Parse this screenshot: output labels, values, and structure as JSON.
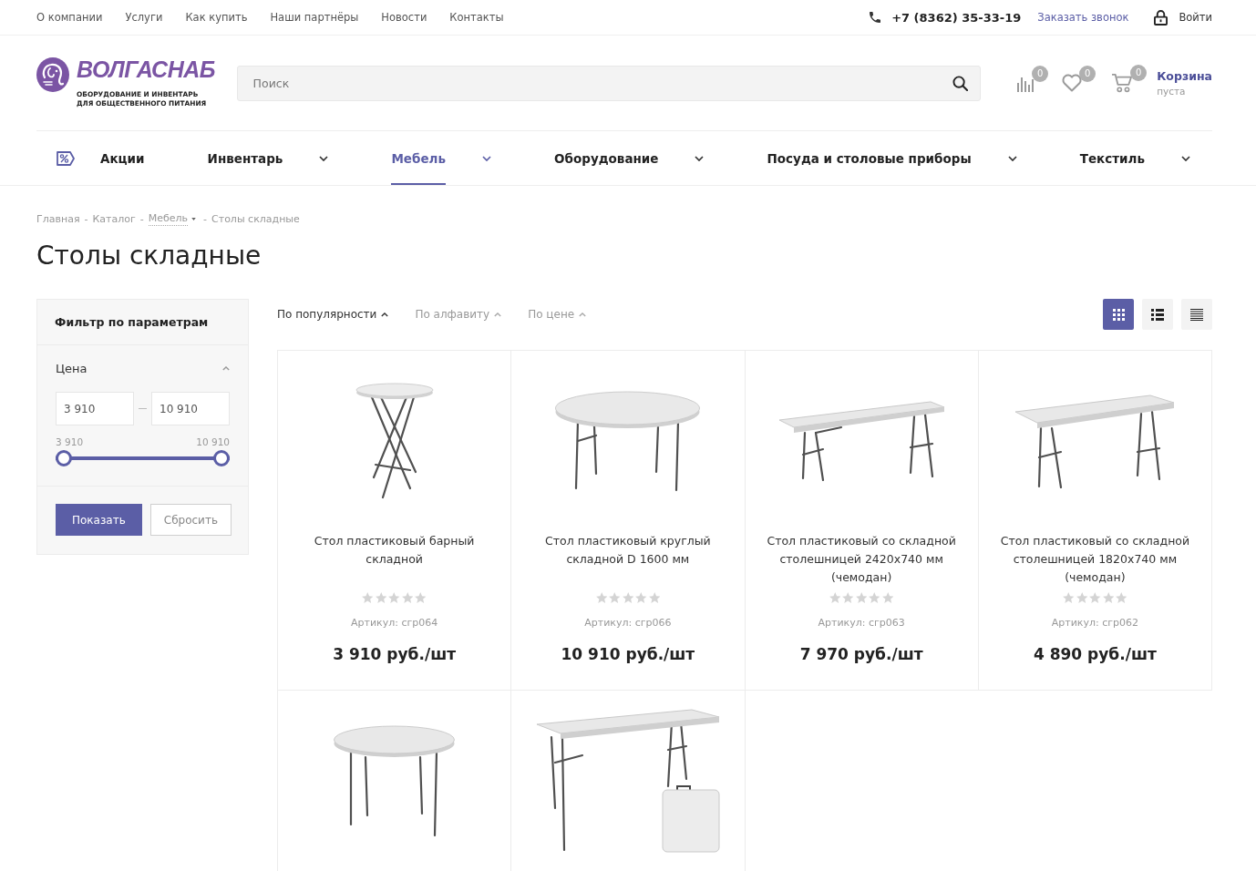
{
  "top_bar": {
    "links": [
      "О компании",
      "Услуги",
      "Как купить",
      "Наши партнёры",
      "Новости",
      "Контакты"
    ],
    "phone": "+7 (8362) 35-33-19",
    "callback": "Заказать звонок",
    "login": "Войти"
  },
  "header": {
    "logo": {
      "name": "ВОЛГАСНАБ",
      "tagline": [
        "ОБОРУДОВАНИЕ И ИНВЕНТАРЬ",
        "ДЛЯ ОБЩЕСТВЕННОГО ПИТАНИЯ"
      ]
    },
    "search": {
      "placeholder": "Поиск"
    },
    "counters": [
      {
        "kind": "compare",
        "count": "0"
      },
      {
        "kind": "favorites",
        "count": "0"
      },
      {
        "kind": "cart",
        "count": "0"
      }
    ],
    "cart": {
      "title": "Корзина",
      "status": "пуста"
    }
  },
  "nav": [
    {
      "label": "Акции",
      "kind": "promo",
      "selected": false
    },
    {
      "label": "Инвентарь",
      "kind": "menu",
      "selected": false
    },
    {
      "label": "Мебель",
      "kind": "menu",
      "selected": true
    },
    {
      "label": "Оборудование",
      "kind": "menu",
      "selected": false
    },
    {
      "label": "Посуда и столовые приборы",
      "kind": "menu",
      "selected": false
    },
    {
      "label": "Текстиль",
      "kind": "menu",
      "selected": false
    }
  ],
  "breadcrumbs": {
    "separator": "-",
    "items": [
      {
        "label": "Главная",
        "dropdown": false
      },
      {
        "label": "Каталог",
        "dropdown": false
      },
      {
        "label": "Мебель",
        "dropdown": true
      },
      {
        "label": "Столы складные",
        "dropdown": false
      }
    ]
  },
  "title": "Столы складные",
  "filter": {
    "title": "Фильтр по параметрам",
    "section": {
      "label": "Цена",
      "expanded": true,
      "from": {
        "value": "3 910"
      },
      "to": {
        "value": "10 910"
      },
      "min_label": "3 910",
      "max_label": "10 910",
      "level": 1
    },
    "buttons": [
      {
        "label": "Показать",
        "kind": "primary"
      },
      {
        "label": "Сбросить",
        "kind": "secondary"
      }
    ]
  },
  "sort": [
    {
      "label": "По популярности",
      "selected": true
    },
    {
      "label": "По алфавиту",
      "selected": false
    },
    {
      "label": "По цене",
      "selected": false
    }
  ],
  "views": [
    {
      "kind": "grid",
      "selected": true
    },
    {
      "kind": "list",
      "selected": false
    },
    {
      "kind": "table",
      "selected": false
    }
  ],
  "products": [
    {
      "kind": "bar",
      "title": "Стол пластиковый барный складной",
      "stars": 0,
      "article": "Артикул: сгр064",
      "price": "3 910 руб./шт"
    },
    {
      "kind": "round",
      "title": "Стол пластиковый круглый складной D 1600 мм",
      "stars": 0,
      "article": "Артикул: сгр066",
      "price": "10 910 руб./шт"
    },
    {
      "kind": "long",
      "title": "Стол пластиковый со складной столешницей 2420х740 мм (чемодан)",
      "stars": 0,
      "article": "Артикул: сгр063",
      "price": "7 970 руб./шт"
    },
    {
      "kind": "rect",
      "title": "Стол пластиковый со складной столешницей 1820х740 мм (чемодан)",
      "stars": 0,
      "article": "Артикул: сгр062",
      "price": "4 890 руб./шт"
    },
    {
      "kind": "round-small"
    },
    {
      "kind": "folding-case"
    }
  ]
}
